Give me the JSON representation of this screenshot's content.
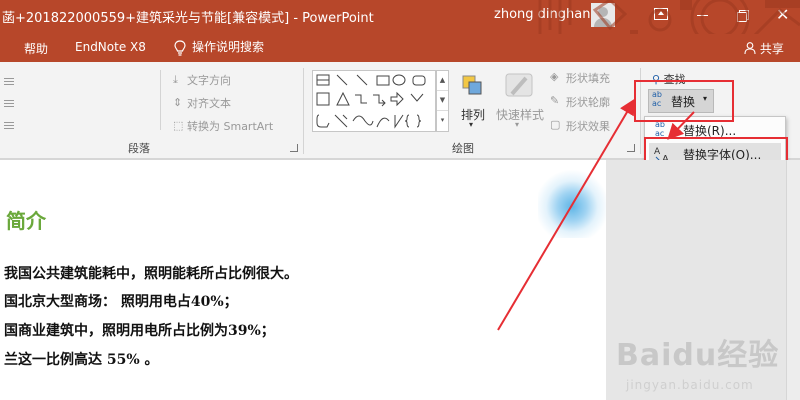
{
  "window": {
    "title": "菡+201822000559+建筑采光与节能[兼容模式]  -  PowerPoint",
    "user_name": "zhong dinghan",
    "close_glyph": "✕"
  },
  "tabs": {
    "help": "帮助",
    "endnote": "EndNote X8",
    "tell_me": "操作说明搜索",
    "share": "共享"
  },
  "paragraph_group": {
    "text_direction": "文字方向",
    "align_text": "对齐文本",
    "convert_smartart": "转换为 SmartArt",
    "label": "段落"
  },
  "drawing_group": {
    "arrange": "排列",
    "quick_styles": "快速样式",
    "shape_fill": "形状填充",
    "shape_outline": "形状轮廓",
    "shape_effects": "形状效果",
    "label": "绘图"
  },
  "editing_group": {
    "find": "查找",
    "replace": "替换",
    "ab_top": "ab",
    "ab_bottom": "ac"
  },
  "replace_menu": {
    "items": [
      "替换(R)...",
      "替换字体(O)..."
    ]
  },
  "slide": {
    "heading": "简介",
    "bullets": [
      "我国公共建筑能耗中，照明能耗所占比例很大。",
      "国北京大型商场：  照明用电占40%；",
      "国商业建筑中，照明用电所占比例为39%；",
      "兰这一比例高达  55%  。"
    ]
  },
  "watermark": {
    "logo": "Baidu经验",
    "url": "jingyan.baidu.com"
  },
  "colors": {
    "title_bar": "#b7472a",
    "ribbon": "#f3f3f3",
    "heading_green": "#6aa83b",
    "annotation_red": "#e62e34"
  }
}
